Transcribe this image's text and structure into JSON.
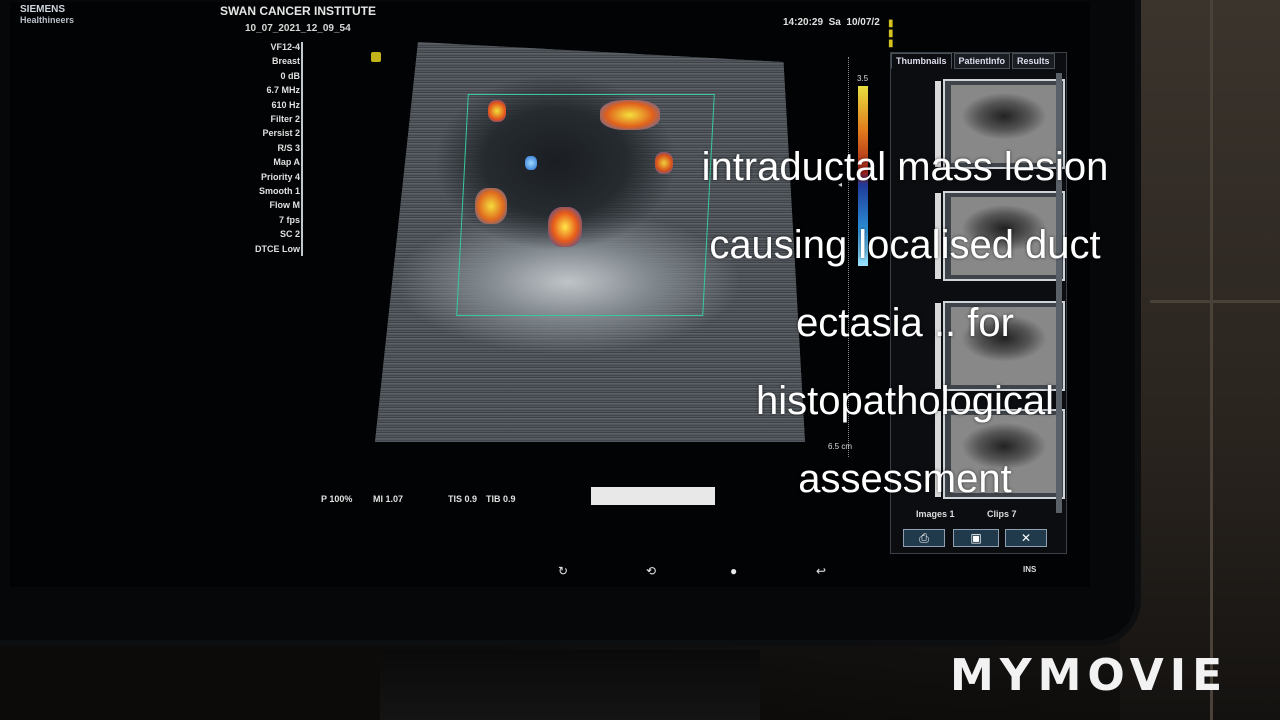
{
  "header": {
    "brand_line1": "SIEMENS",
    "brand_line2": "Healthineers",
    "institute": "SWAN CANCER INSTITUTE",
    "exam_id": "10_07_2021_12_09_54",
    "time": "14:20:29",
    "day": "Sa",
    "date": "10/07/2"
  },
  "params": [
    "VF12-4",
    "Breast",
    "0 dB",
    "6.7 MHz",
    "610 Hz",
    "Filter 2",
    "Persist 2",
    "R/S 3",
    "Map A",
    "Priority 4",
    "Smooth 1",
    "Flow M",
    "7 fps",
    "SC 2",
    "DTCE Low"
  ],
  "color_scale": {
    "top": "3.5",
    "depth": "6.5 cm"
  },
  "readouts": {
    "power": "P 100%",
    "mi": "MI 1.07",
    "tis": "TIS 0.9",
    "tib": "TIB 0.9"
  },
  "panel": {
    "tabs": [
      "Thumbnails",
      "PatientInfo",
      "Results"
    ],
    "images_label": "Images 1",
    "clips_label": "Clips 7"
  },
  "footer": {
    "mode": "INS"
  },
  "caption": [
    "intraductal mass lesion",
    "causing localised duct",
    "ectasia .. for",
    "histopathological",
    "assessment"
  ],
  "watermark": "MYMOVIE"
}
